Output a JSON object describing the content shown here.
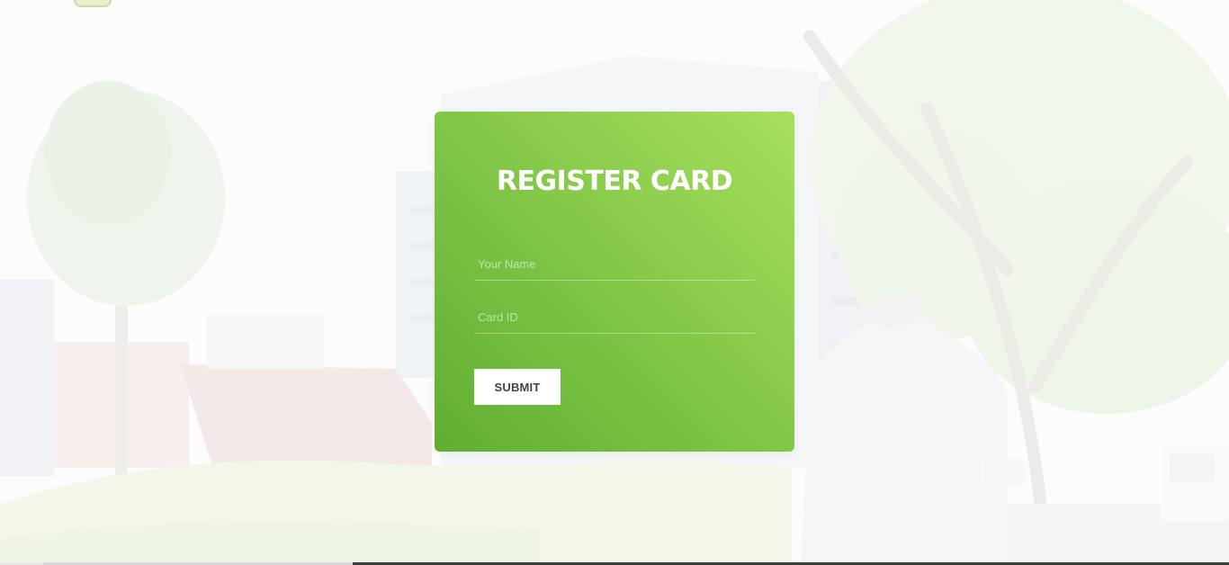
{
  "form": {
    "title": "REGISTER CARD",
    "name_placeholder": "Your Name",
    "name_value": "",
    "card_placeholder": "Card ID",
    "card_value": "",
    "submit_label": "SUBMIT"
  },
  "colors": {
    "card_gradient_light": "#a8df5e",
    "card_gradient_dark": "#5fae32",
    "button_bg": "#ffffff",
    "button_text": "#444444"
  },
  "icons": {
    "logo": "campus-logo-icon"
  }
}
